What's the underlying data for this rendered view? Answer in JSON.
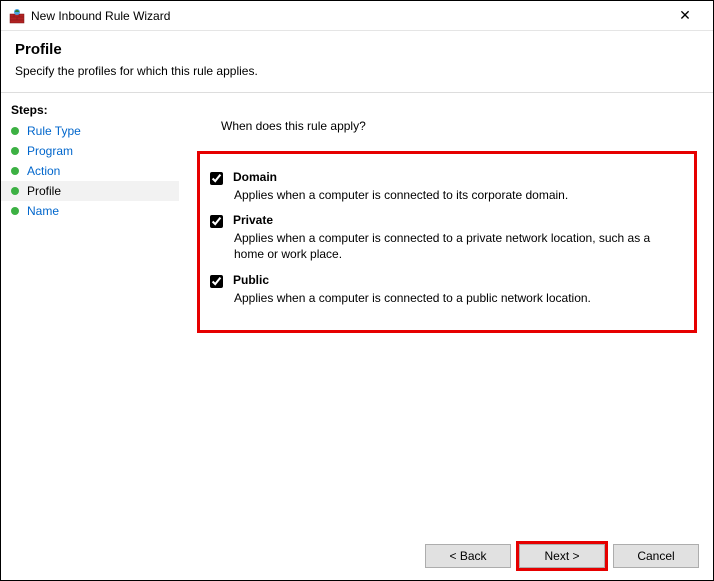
{
  "window": {
    "title": "New Inbound Rule Wizard"
  },
  "header": {
    "title": "Profile",
    "subtitle": "Specify the profiles for which this rule applies."
  },
  "sidebar": {
    "steps_label": "Steps:",
    "items": [
      {
        "label": "Rule Type"
      },
      {
        "label": "Program"
      },
      {
        "label": "Action"
      },
      {
        "label": "Profile"
      },
      {
        "label": "Name"
      }
    ]
  },
  "content": {
    "prompt": "When does this rule apply?",
    "options": [
      {
        "label": "Domain",
        "description": "Applies when a computer is connected to its corporate domain."
      },
      {
        "label": "Private",
        "description": "Applies when a computer is connected to a private network location, such as a home or work place."
      },
      {
        "label": "Public",
        "description": "Applies when a computer is connected to a public network location."
      }
    ]
  },
  "footer": {
    "back": "< Back",
    "next": "Next >",
    "cancel": "Cancel"
  }
}
